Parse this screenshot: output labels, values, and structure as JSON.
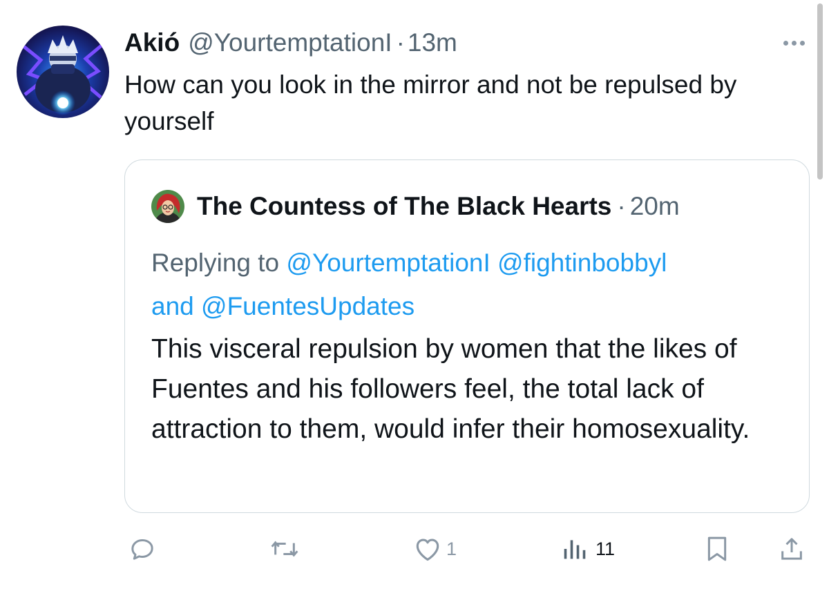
{
  "colors": {
    "link": "#1d9bf0",
    "secondary_text": "#536471",
    "primary_text": "#0f1419",
    "border": "#cfd9de"
  },
  "tweet": {
    "author_name": "Akió",
    "handle": "@YourtemptationI",
    "separator": "·",
    "time": "13m",
    "text": "How can you look in the mirror and not be repulsed by yourself",
    "avatar_icon": "anime-character-avatar",
    "more_icon": "more-dots-icon"
  },
  "quote": {
    "author_name": "The Countess of The Black Hearts",
    "separator": "·",
    "time": "20m",
    "replying_prefix": "Replying to",
    "mention_1": "@YourtemptationI",
    "mention_2": "@fightinbobbyl",
    "and_word": "and",
    "mention_3": "@FuentesUpdates",
    "text": "This visceral repulsion by women that the likes of Fuentes and his followers feel, the total lack of attraction to them, would infer their homosexuality.",
    "avatar_icon": "cartoon-woman-avatar"
  },
  "actions": {
    "reply_icon": "reply-icon",
    "retweet_icon": "retweet-icon",
    "like_icon": "heart-icon",
    "like_count": "1",
    "views_icon": "views-icon",
    "views_count": "11",
    "bookmark_icon": "bookmark-icon",
    "share_icon": "share-icon"
  }
}
